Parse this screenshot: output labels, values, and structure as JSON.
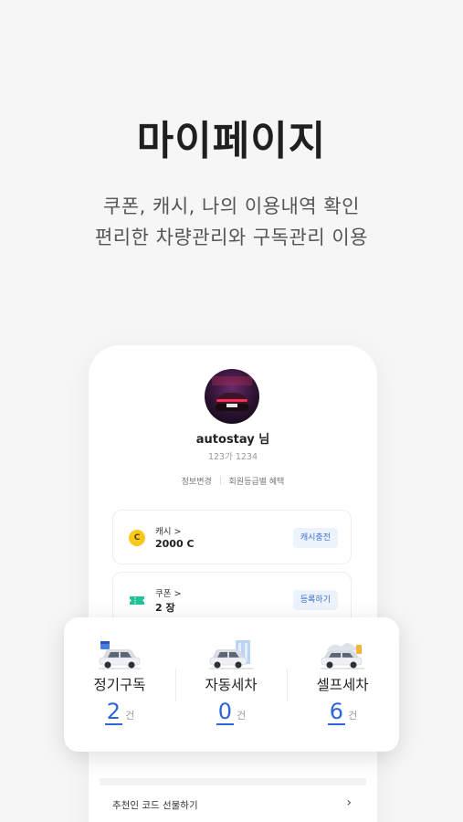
{
  "hero": {
    "title": "마이페이지",
    "subtitle_line1": "쿠폰, 캐시, 나의 이용내역 확인",
    "subtitle_line2": "편리한 차량관리와 구독관리 이용"
  },
  "profile": {
    "username": "autostay 님",
    "user_code": "123가 1234",
    "link_edit": "정보변경",
    "link_grade": "회원등급별 혜택"
  },
  "cash": {
    "label": "캐시 >",
    "value": "2000 C",
    "icon_glyph": "C",
    "button": "캐시충전"
  },
  "coupon": {
    "label": "쿠폰 >",
    "value": "2 장",
    "button": "등록하기"
  },
  "services": [
    {
      "name": "정기구독",
      "count": "2",
      "unit": "건",
      "icon": "subscription-car-icon"
    },
    {
      "name": "자동세차",
      "count": "0",
      "unit": "건",
      "icon": "auto-wash-car-icon"
    },
    {
      "name": "셀프세차",
      "count": "6",
      "unit": "건",
      "icon": "self-wash-car-icon"
    }
  ],
  "recommend": {
    "label": "추천인 코드 선물하기",
    "chevron": "›"
  },
  "colors": {
    "accent": "#2c66d8",
    "coin": "#f7c81e",
    "coupon": "#22c39a",
    "background": "#f6f6f7"
  }
}
